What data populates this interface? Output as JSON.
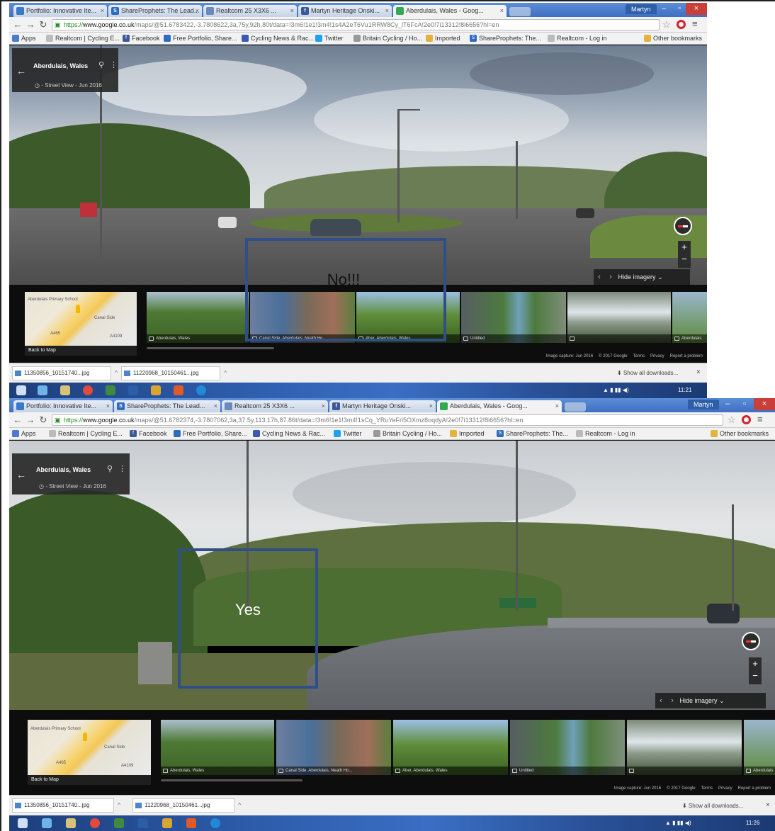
{
  "screenshots": [
    {
      "tabs": [
        {
          "label": "Portfolio: Innovative Ite...",
          "icon": "portfolio-icon",
          "color": "#3a78c8"
        },
        {
          "label": "ShareProphets: The Lead...",
          "icon": "shareprophets-icon",
          "color": "#2f6cc0"
        },
        {
          "label": "Realtcom 25 X3X6 ...",
          "icon": "realtcom-icon",
          "color": "#6a8ab8"
        },
        {
          "label": "Martyn Heritage Onski...",
          "icon": "facebook-icon",
          "color": "#3b5998"
        },
        {
          "label": "Aberdulais, Wales - Goog...",
          "icon": "maps-icon",
          "color": "#34a853"
        }
      ],
      "user": "Martyn",
      "url": {
        "https": "https://",
        "domain": "www.google.co.uk",
        "path": "/maps/@51.6783422,-3.7808622,3a,75y,92h,80t/data=!3m6!1e1!3m4!1s4A2eT6Vu1RRW8Cy_lT6FcA!2e0!7i13312!8i6656?hl=en"
      },
      "bookmarks": [
        {
          "label": "Apps",
          "color": "#4a7bd0"
        },
        {
          "label": "Realtcom | Cycling E...",
          "color": "#888"
        },
        {
          "label": "Facebook",
          "color": "#3b5998"
        },
        {
          "label": "Free Portfolio, Share...",
          "color": "#2f6cc0"
        },
        {
          "label": "Cycling News & Rac...",
          "color": "#3b5bb0"
        },
        {
          "label": "Twitter",
          "color": "#1da1f2"
        },
        {
          "label": "Britain Cycling / Ho...",
          "color": "#888"
        },
        {
          "label": "Imported",
          "color": "#e3b341"
        },
        {
          "label": "ShareProphets: The...",
          "color": "#2f6cc0"
        },
        {
          "label": "Realtcom - Log in",
          "color": "#888"
        },
        {
          "label": "Other bookmarks",
          "color": "#e3b341"
        }
      ],
      "infocard": {
        "place": "Aberdulais, Wales",
        "date": "Street View - Jun 2016"
      },
      "hide_imagery": "Hide imagery",
      "minimap": {
        "back": "Back to Map",
        "labels": [
          "Aberdulais Primary School",
          "A465",
          "Canal Side",
          "A4109"
        ]
      },
      "thumbs": [
        {
          "caption": "Aberdulais, Wales",
          "icon": "street-view-icon"
        },
        {
          "caption": "Canal Side, Aberdulais, Neath Ho...",
          "icon": "photo-icon"
        },
        {
          "caption": "Aber, Aberdulais, Wales",
          "icon": "street-view-icon"
        },
        {
          "caption": "Untitled",
          "icon": "photo-icon"
        },
        {
          "caption": "",
          "icon": "photo-icon"
        },
        {
          "caption": "Aberdulais",
          "icon": "street-view-icon"
        }
      ],
      "footer": [
        "Image capture: Jun 2016",
        "© 2017 Google",
        "Terms",
        "Privacy",
        "Report a problem"
      ],
      "downloads": [
        "11350856_10151740...jpg",
        "11220968_10150461...jpg"
      ],
      "show_all": "Show all downloads...",
      "clock": "11:21"
    },
    {
      "tabs": [
        {
          "label": "Portfolio: Innovative Ite...",
          "icon": "portfolio-icon",
          "color": "#3a78c8"
        },
        {
          "label": "ShareProphets: The Lead...",
          "icon": "shareprophets-icon",
          "color": "#2f6cc0"
        },
        {
          "label": "Realtcom 25 X3X6 ...",
          "icon": "realtcom-icon",
          "color": "#6a8ab8"
        },
        {
          "label": "Martyn Heritage Onski...",
          "icon": "facebook-icon",
          "color": "#3b5998"
        },
        {
          "label": "Aberdulais, Wales - Goog...",
          "icon": "maps-icon",
          "color": "#34a853"
        }
      ],
      "user": "Martyn",
      "url": {
        "https": "https://",
        "domain": "www.google.co.uk",
        "path": "/maps/@51.6782374,-3.7807062,3a,37.5y,113.17h,87.86t/data=!3m6!1e1!3m4!1sCq_YRuYeFri5OXmz8oqdyA!2e0!7i13312!8i6656?hl=en"
      },
      "bookmarks": [
        {
          "label": "Apps",
          "color": "#4a7bd0"
        },
        {
          "label": "Realtcom | Cycling E...",
          "color": "#888"
        },
        {
          "label": "Facebook",
          "color": "#3b5998"
        },
        {
          "label": "Free Portfolio, Share...",
          "color": "#2f6cc0"
        },
        {
          "label": "Cycling News & Rac...",
          "color": "#3b5bb0"
        },
        {
          "label": "Twitter",
          "color": "#1da1f2"
        },
        {
          "label": "Britain Cycling / Ho...",
          "color": "#888"
        },
        {
          "label": "Imported",
          "color": "#e3b341"
        },
        {
          "label": "ShareProphets: The...",
          "color": "#2f6cc0"
        },
        {
          "label": "Realtcom - Log in",
          "color": "#888"
        },
        {
          "label": "Other bookmarks",
          "color": "#e3b341"
        }
      ],
      "infocard": {
        "place": "Aberdulais, Wales",
        "date": "Street View - Jun 2016"
      },
      "hide_imagery": "Hide imagery",
      "minimap": {
        "back": "Back to Map",
        "labels": [
          "Aberdulais Primary School",
          "A465",
          "Canal Side",
          "A4109"
        ]
      },
      "thumbs": [
        {
          "caption": "Aberdulais, Wales",
          "icon": "street-view-icon"
        },
        {
          "caption": "Canal Side, Aberdulais, Neath Ho...",
          "icon": "photo-icon"
        },
        {
          "caption": "Aber, Aberdulais, Wales",
          "icon": "street-view-icon"
        },
        {
          "caption": "Untitled",
          "icon": "photo-icon"
        },
        {
          "caption": "",
          "icon": "photo-icon"
        },
        {
          "caption": "Aberdulais",
          "icon": "street-view-icon"
        }
      ],
      "footer": [
        "Image capture: Jun 2016",
        "© 2017 Google",
        "Terms",
        "Privacy",
        "Report a problem"
      ],
      "downloads": [
        "11350856_10151740...jpg",
        "11220968_10150461...jpg"
      ],
      "show_all": "Show all downloads...",
      "clock": "11:26"
    }
  ],
  "annotations": {
    "no_label": "No!!!",
    "yes_label": "Yes",
    "box_color": "#2f4f86",
    "no_text_color": "#111111",
    "yes_text_color": "#ffffff"
  },
  "colors": {
    "titlebar": "#4a7ccc",
    "close_button": "#c9403a",
    "taskbar": "#2c5aa8",
    "opera": "#d4212b"
  }
}
